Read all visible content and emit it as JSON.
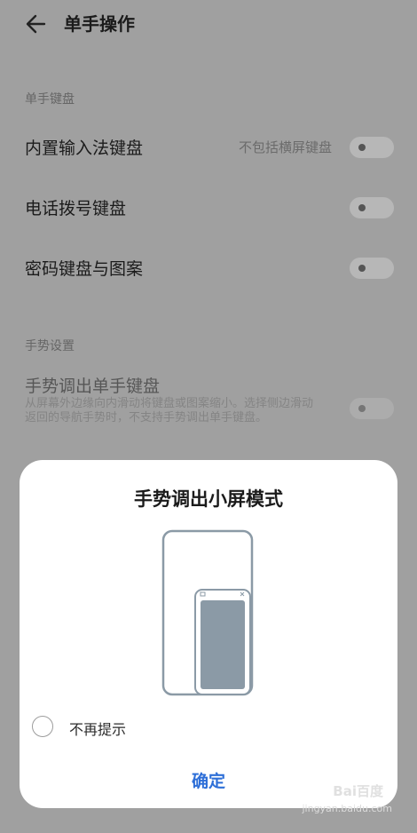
{
  "header": {
    "title": "单手操作"
  },
  "sections": {
    "keyboard": {
      "title": "单手键盘",
      "items": [
        {
          "label": "内置输入法键盘",
          "note": "不包括横屏键盘"
        },
        {
          "label": "电话拨号键盘"
        },
        {
          "label": "密码键盘与图案"
        }
      ]
    },
    "gesture": {
      "title": "手势设置",
      "item": {
        "label": "手势调出单手键盘",
        "description": "从屏幕外边缘向内滑动将键盘或图案缩小。选择侧边滑动返回的导航手势时，不支持手势调出单手键盘。"
      }
    }
  },
  "dialog": {
    "title": "手势调出小屏模式",
    "checkbox_label": "不再提示",
    "confirm_label": "确定"
  },
  "watermark": {
    "logo": "Bai百度",
    "url": "jingyan.baidu.com"
  },
  "colors": {
    "accent": "#2e6fd8",
    "overlay": "#a0a0a0",
    "screen_fill": "#8b9aa6"
  }
}
